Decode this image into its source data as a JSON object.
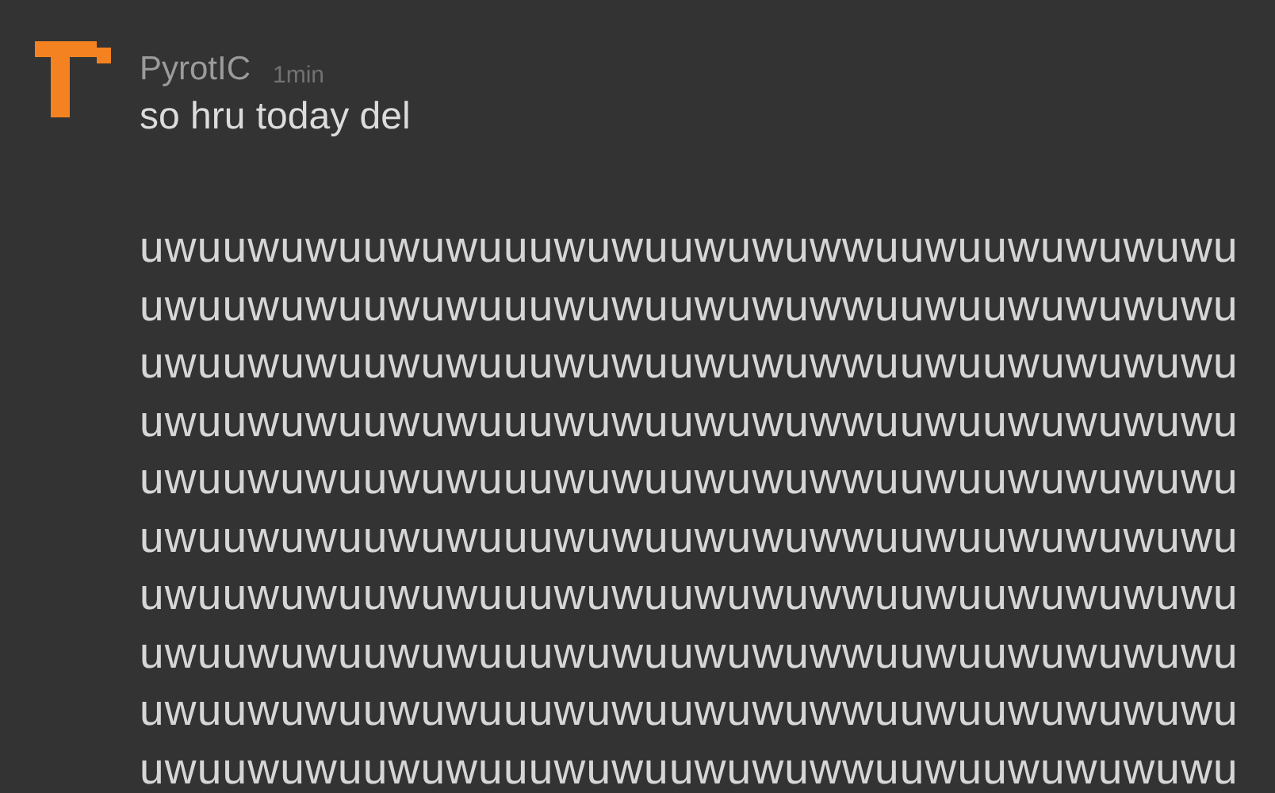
{
  "post": {
    "author": "PyrotIC",
    "time": "1min",
    "message": "so hru today del",
    "lines": [
      "uwuuwuwuuwuwuuuwuwuuwuwuwwuuwuuwuwuwuwu",
      "uwuuwuwuuwuwuuuwuwuuwuwuwwuuwuuwuwuwuwu",
      "uwuuwuwuuwuwuuuwuwuuwuwuwwuuwuuwuwuwuwu",
      "uwuuwuwuuwuwuuuwuwuuwuwuwwuuwuuwuwuwuwu",
      "uwuuwuwuuwuwuuuwuwuuwuwuwwuuwuuwuwuwuwu",
      "uwuuwuwuuwuwuuuwuwuuwuwuwwuuwuuwuwuwuwu",
      "uwuuwuwuuwuwuuuwuwuuwuwuwwuuwuuwuwuwuwu",
      "uwuuwuwuuwuwuuuwuwuuwuwuwwuuwuuwuwuwuwu",
      "uwuuwuwuuwuwuuuwuwuuwuwuwwuuwuuwuwuwuwu",
      "uwuuwuwuuwuwuuuwuwuuwuwuwwuuwuuwuwuwuwu"
    ]
  }
}
